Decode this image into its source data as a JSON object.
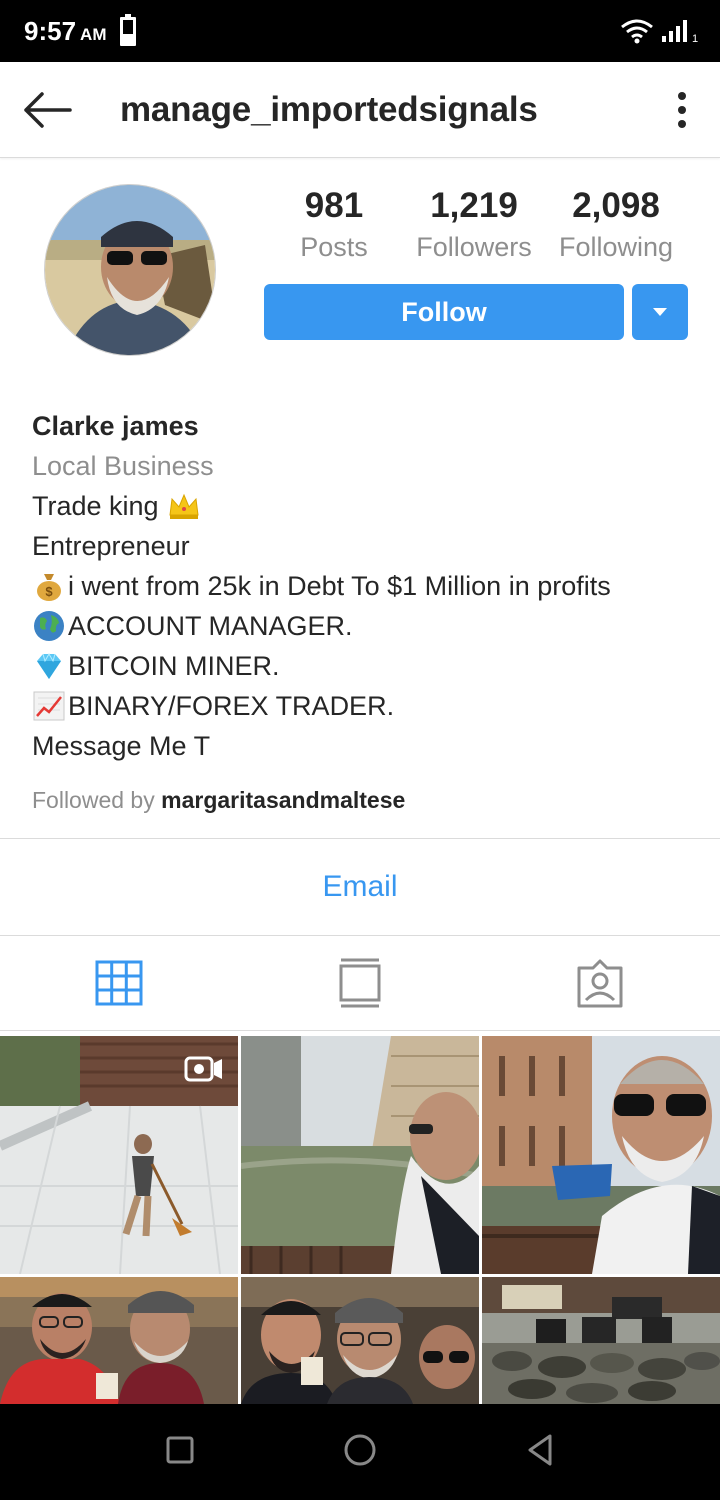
{
  "status_bar": {
    "time": "9:57",
    "ampm": "AM",
    "icons": [
      "battery-icon",
      "wifi-icon",
      "signal-icon"
    ],
    "signal_sim": "1"
  },
  "header": {
    "username": "manage_importedsignals",
    "back_icon": "arrow-left-icon",
    "menu_icon": "vertical-dots-icon"
  },
  "profile": {
    "stats": [
      {
        "value": "981",
        "label": "Posts"
      },
      {
        "value": "1,219",
        "label": "Followers"
      },
      {
        "value": "2,098",
        "label": "Following"
      }
    ],
    "follow_label": "Follow",
    "name": "Clarke james",
    "category": "Local Business",
    "bio": {
      "line1": "Trade king",
      "line2": "Entrepreneur",
      "line3": "i went from 25k in Debt To $1 Million in profits",
      "line4": "ACCOUNT MANAGER.",
      "line5": "BITCOIN MINER.",
      "line6": "BINARY/FOREX TRADER.",
      "line7": "Message Me T"
    },
    "followed_by_prefix": "Followed by",
    "followed_by_user": "margaritasandmaltese"
  },
  "actions": {
    "email_label": "Email"
  },
  "tabs": [
    {
      "icon": "grid-icon",
      "active": true
    },
    {
      "icon": "feed-icon",
      "active": false
    },
    {
      "icon": "tagged-icon",
      "active": false
    }
  ],
  "colors": {
    "accent": "#3897f0",
    "text": "#262626",
    "muted": "#8e8e8e",
    "divider": "#dbdbdb"
  }
}
